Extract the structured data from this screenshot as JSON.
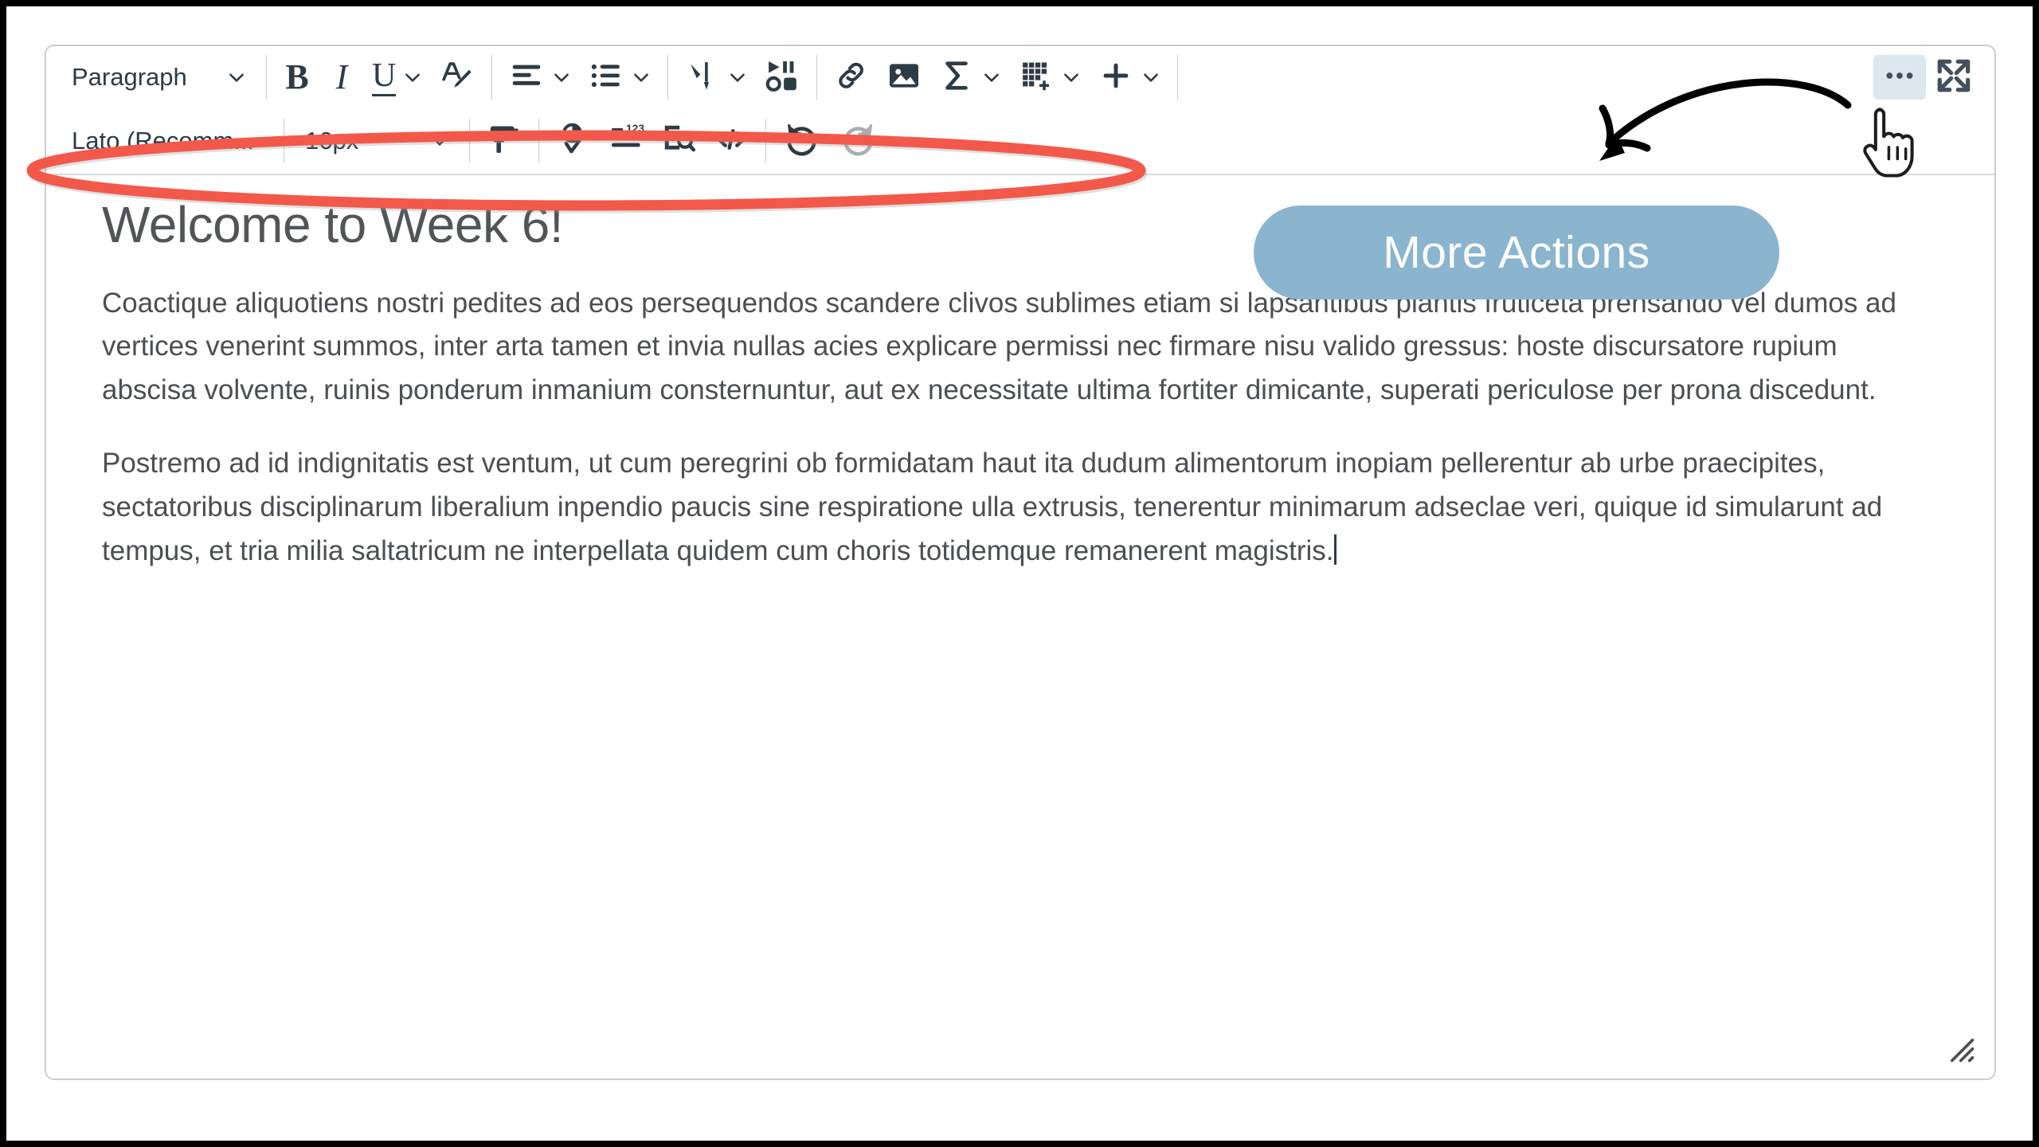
{
  "editor": {
    "toolbar_row1": [
      {
        "name": "block-format-select",
        "label": "Paragraph",
        "kind": "select",
        "icon": "chevron-down-icon"
      },
      {
        "name": "separator-1",
        "kind": "separator"
      },
      {
        "name": "bold-button",
        "label": "B",
        "kind": "text-icon",
        "icon": "bold-icon"
      },
      {
        "name": "italic-button",
        "label": "I",
        "kind": "text-icon",
        "icon": "italic-icon"
      },
      {
        "name": "underline-button",
        "label": "U",
        "kind": "text-icon",
        "icon": "underline-icon"
      },
      {
        "name": "text-color-button",
        "kind": "icon",
        "icon": "text-color-icon"
      },
      {
        "name": "separator-2",
        "kind": "separator"
      },
      {
        "name": "align-button",
        "kind": "icon",
        "icon": "align-left-icon"
      },
      {
        "name": "list-button",
        "kind": "icon",
        "icon": "bulleted-list-icon"
      },
      {
        "name": "separator-3",
        "kind": "separator"
      },
      {
        "name": "indent-button",
        "kind": "icon",
        "icon": "indent-arrow-icon"
      },
      {
        "name": "media-button",
        "kind": "icon",
        "icon": "media-icon"
      },
      {
        "name": "link-button",
        "kind": "icon",
        "icon": "link-icon"
      },
      {
        "name": "image-button",
        "kind": "icon",
        "icon": "image-icon"
      },
      {
        "name": "equation-button",
        "kind": "icon",
        "icon": "sigma-equation-icon"
      },
      {
        "name": "table-button",
        "kind": "icon",
        "icon": "table-add-icon"
      },
      {
        "name": "insert-button",
        "kind": "icon",
        "icon": "plus-icon"
      },
      {
        "name": "separator-4",
        "kind": "separator"
      },
      {
        "name": "more-actions-button",
        "kind": "icon",
        "icon": "ellipsis-icon",
        "highlighted": true
      },
      {
        "name": "fullscreen-button",
        "kind": "icon",
        "icon": "fullscreen-expand-icon"
      }
    ],
    "toolbar_row2": [
      {
        "name": "font-family-select",
        "label": "Lato (Recomm...",
        "kind": "select",
        "icon": "chevron-down-icon"
      },
      {
        "name": "separator-5",
        "kind": "separator"
      },
      {
        "name": "font-size-select",
        "label": "16px",
        "kind": "select",
        "icon": "chevron-down-icon"
      },
      {
        "name": "separator-6",
        "kind": "separator"
      },
      {
        "name": "format-painter-button",
        "kind": "icon",
        "icon": "paint-roller-icon"
      },
      {
        "name": "separator-7",
        "kind": "separator"
      },
      {
        "name": "accessibility-checker-button",
        "kind": "icon",
        "icon": "accessibility-check-icon"
      },
      {
        "name": "word-count-button",
        "kind": "icon",
        "icon": "word-count-icon"
      },
      {
        "name": "find-replace-button",
        "kind": "icon",
        "icon": "document-search-icon"
      },
      {
        "name": "html-editor-button",
        "kind": "icon",
        "icon": "code-brackets-icon"
      },
      {
        "name": "separator-8",
        "kind": "separator"
      },
      {
        "name": "undo-button",
        "kind": "icon",
        "icon": "undo-icon"
      },
      {
        "name": "redo-button",
        "kind": "icon",
        "icon": "redo-icon",
        "disabled": true
      }
    ],
    "block_format": "Paragraph",
    "font_family": "Lato (Recomm...",
    "font_size": "16px",
    "bold_label": "B",
    "italic_label": "I",
    "underline_label": "U"
  },
  "document": {
    "title": "Welcome to Week 6!",
    "paragraph_1": "Coactique aliquotiens nostri pedites ad eos persequendos scandere clivos sublimes etiam si lapsantibus plantis fruticeta prensando vel dumos ad vertices venerint summos, inter arta tamen et invia nullas acies explicare permissi nec firmare nisu valido gressus: hoste discursatore rupium abscisa volvente, ruinis ponderum inmanium consternuntur, aut ex necessitate ultima fortiter dimicante, superati periculose per prona discedunt.",
    "paragraph_2": "Postremo ad id indignitatis est ventum, ut cum peregrini ob formidatam haut ita dudum alimentorum inopiam pellerentur ab urbe praecipites, sectatoribus disciplinarum liberalium inpendio paucis sine respiratione ulla extrusis, tenerentur minimarum adseclae veri, quique id simularunt ad tempus, et tria milia saltatricum ne interpellata quidem cum choris totidemque remanerent magistris."
  },
  "annotations": {
    "callout_label": "More Actions",
    "callout_color": "#8bb4ce",
    "callout_text_color": "#ffffff",
    "ellipse_color": "#f2594b",
    "arrow_color": "#000000",
    "highlight_color": "#dde7ef"
  },
  "colors": {
    "toolbar_icon": "#2d3b45",
    "disabled_icon": "#9ea6ad",
    "body_text": "#4b4e53",
    "title_text": "#515459",
    "border": "#c7cdd1",
    "frame": "#000000",
    "page_background": "#ffffff"
  }
}
